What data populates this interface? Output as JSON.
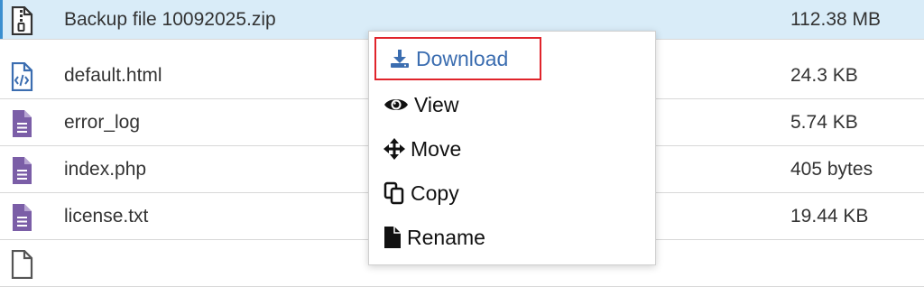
{
  "files": [
    {
      "name": "Backup file 10092025.zip",
      "size": "112.38 MB",
      "icon": "zip-file-icon",
      "selected": true
    },
    {
      "name": "default.html",
      "size": "24.3 KB",
      "icon": "html-file-icon"
    },
    {
      "name": "error_log",
      "size": "5.74 KB",
      "icon": "text-file-icon"
    },
    {
      "name": "index.php",
      "size": "405 bytes",
      "icon": "text-file-icon"
    },
    {
      "name": "license.txt",
      "size": "19.44 KB",
      "icon": "text-file-icon"
    },
    {
      "name": "",
      "size": "",
      "icon": "file-icon"
    }
  ],
  "context_menu": {
    "items": [
      {
        "label": "Download",
        "icon": "download-icon",
        "highlighted": true
      },
      {
        "label": "View",
        "icon": "eye-icon"
      },
      {
        "label": "Move",
        "icon": "move-arrows-icon"
      },
      {
        "label": "Copy",
        "icon": "copy-icon"
      },
      {
        "label": "Rename",
        "icon": "file-icon"
      }
    ]
  },
  "colors": {
    "selected_row": "#d9ecf8",
    "file_icon": "#7b5ea7",
    "html_icon": "#3b6db0",
    "highlight_border": "#e0242b",
    "download_text": "#3b6db0"
  }
}
